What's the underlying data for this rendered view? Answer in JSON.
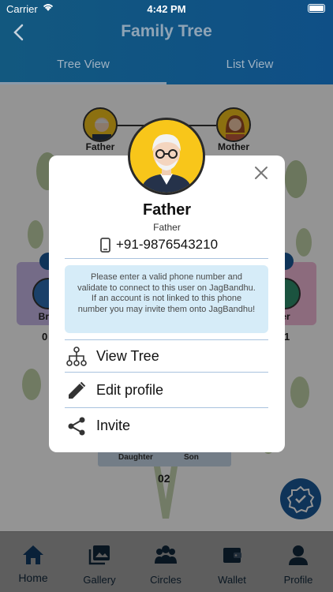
{
  "status_bar": {
    "carrier": "Carrier",
    "time": "4:42 PM"
  },
  "header": {
    "title": "Family Tree"
  },
  "tabs": [
    {
      "label": "Tree View",
      "active": true
    },
    {
      "label": "List View",
      "active": false
    }
  ],
  "tree": {
    "father_label": "Father",
    "mother_label": "Mother",
    "left_card_label": "Bro",
    "right_card_label": "ter",
    "left_count": "0",
    "right_count": "1",
    "daughter_label": "Daughter",
    "son_label": "Son",
    "children_count": "02"
  },
  "modal": {
    "name": "Father",
    "relation": "Father",
    "phone": "+91-9876543210",
    "info": "Please enter a valid phone number and validate to connect to this user on JagBandhu. If an account is not linked to this phone number you may invite them onto JagBandhu!",
    "actions": [
      {
        "label": "View Tree",
        "icon": "tree-icon"
      },
      {
        "label": "Edit profile",
        "icon": "pencil-icon"
      },
      {
        "label": "Invite",
        "icon": "share-icon"
      }
    ]
  },
  "bottom_nav": [
    {
      "label": "Home",
      "icon": "home-icon"
    },
    {
      "label": "Gallery",
      "icon": "gallery-icon"
    },
    {
      "label": "Circles",
      "icon": "circles-icon"
    },
    {
      "label": "Wallet",
      "icon": "wallet-icon"
    },
    {
      "label": "Profile",
      "icon": "profile-icon"
    }
  ],
  "colors": {
    "header": "#12587f",
    "accent": "#1a5a99",
    "info_bg": "#d6ecf8",
    "avatar_bg": "#f8c61a"
  }
}
